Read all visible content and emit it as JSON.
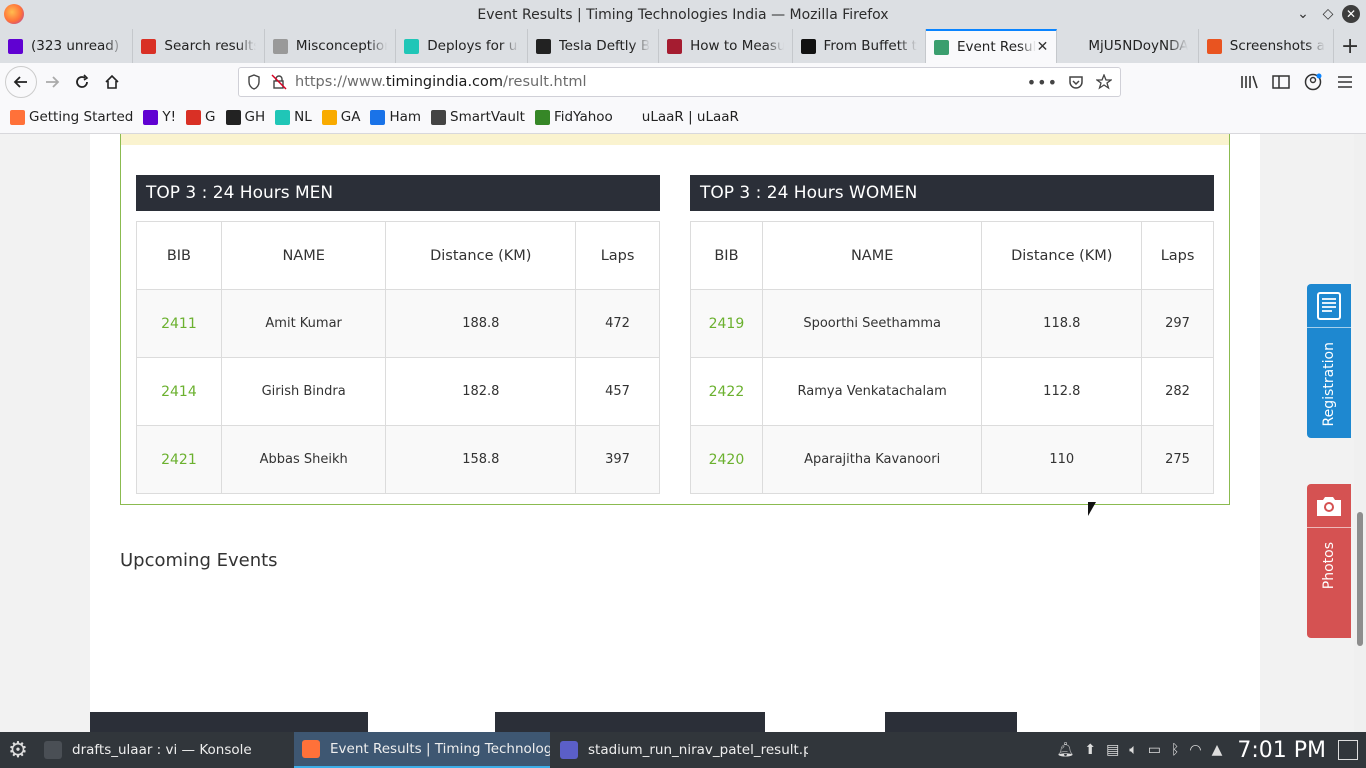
{
  "window": {
    "title": "Event Results | Timing Technologies India — Mozilla Firefox"
  },
  "tabs": [
    {
      "label": "(323 unread) -",
      "icon": "yahoo-mail-icon",
      "color": "#6001d2"
    },
    {
      "label": "Search results",
      "icon": "gmail-icon",
      "color": "#d93025"
    },
    {
      "label": "Misconception",
      "icon": "misc-icon",
      "color": "#999999"
    },
    {
      "label": "Deploys for ula",
      "icon": "netlify-icon",
      "color": "#20c6b7"
    },
    {
      "label": "Tesla Deftly Ba",
      "icon": "b-icon",
      "color": "#222222"
    },
    {
      "label": "How to Measu",
      "icon": "hbr-icon",
      "color": "#a51c30"
    },
    {
      "label": "From Buffett to",
      "icon": "f-icon",
      "color": "#111111"
    },
    {
      "label": "Event Resul",
      "icon": "globe-icon",
      "color": "#3a9e6e",
      "active": true
    },
    {
      "label": "MjU5NDoyNDA",
      "icon": "blank-icon",
      "color": "#dcdfe3"
    },
    {
      "label": "Screenshots ar",
      "icon": "ubuntu-icon",
      "color": "#e95420"
    }
  ],
  "navbar": {
    "url_prefix": "https://www.",
    "url_domain": "timingindia.com",
    "url_path": "/result.html"
  },
  "bookmarks": [
    {
      "label": "Getting Started",
      "icon": "firefox-icon",
      "color": "#ff7139"
    },
    {
      "label": "Y!",
      "icon": "yahoo-mail-icon",
      "color": "#6001d2"
    },
    {
      "label": "G",
      "icon": "gmail-icon",
      "color": "#d93025"
    },
    {
      "label": "GH",
      "icon": "github-icon",
      "color": "#222222"
    },
    {
      "label": "NL",
      "icon": "netlify-icon",
      "color": "#20c6b7"
    },
    {
      "label": "GA",
      "icon": "analytics-icon",
      "color": "#f9ab00"
    },
    {
      "label": "Ham",
      "icon": "ham-icon",
      "color": "#1a73e8"
    },
    {
      "label": "SmartVault",
      "icon": "globe-icon",
      "color": "#444444"
    },
    {
      "label": "FidYahoo",
      "icon": "fid-icon",
      "color": "#368727"
    },
    {
      "label": "uLaaR | uLaaR",
      "icon": "blank-icon",
      "color": "#f9f9fb"
    }
  ],
  "results": {
    "men": {
      "title": "TOP 3 : 24 Hours MEN",
      "headers": [
        "BIB",
        "NAME",
        "Distance (KM)",
        "Laps"
      ],
      "rows": [
        [
          "2411",
          "Amit Kumar",
          "188.8",
          "472"
        ],
        [
          "2414",
          "Girish Bindra",
          "182.8",
          "457"
        ],
        [
          "2421",
          "Abbas Sheikh",
          "158.8",
          "397"
        ]
      ]
    },
    "women": {
      "title": "TOP 3 : 24 Hours WOMEN",
      "headers": [
        "BIB",
        "NAME",
        "Distance (KM)",
        "Laps"
      ],
      "rows": [
        [
          "2419",
          "Spoorthi Seethamma",
          "118.8",
          "297"
        ],
        [
          "2422",
          "Ramya Venkatachalam",
          "112.8",
          "282"
        ],
        [
          "2420",
          "Aparajitha Kavanoori",
          "110",
          "275"
        ]
      ]
    }
  },
  "upcoming_title": "Upcoming Events",
  "side_tabs": {
    "registration": "Registration",
    "photos": "Photos"
  },
  "taskbar": {
    "tasks": [
      {
        "label": "drafts_ulaar : vi — Konsole",
        "color": "#4a4f55"
      },
      {
        "label": "Event Results | Timing Technologi...",
        "color": "#ff7139",
        "active": true
      },
      {
        "label": "stadium_run_nirav_patel_result.pn...",
        "color": "#5b5fc7"
      }
    ],
    "clock": "7:01 PM"
  },
  "colors": {
    "accent_green": "#6bb12f",
    "panel_header": "#2b2f38",
    "registration_blue": "#1e88d0",
    "photos_red": "#d55252"
  }
}
